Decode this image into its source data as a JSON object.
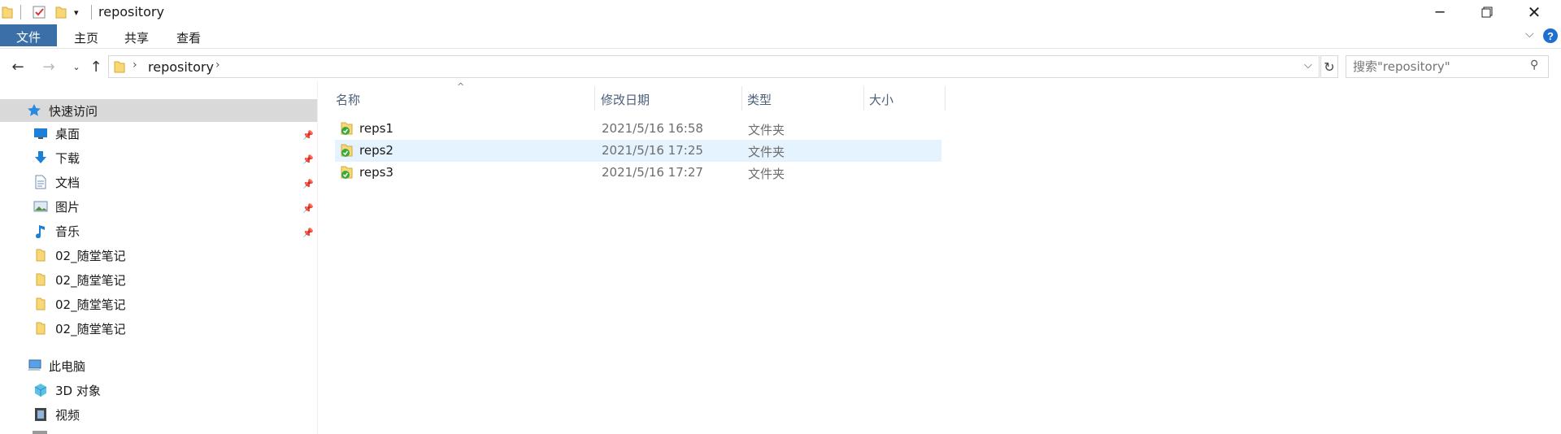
{
  "window": {
    "title": "repository",
    "controls": [
      "minimize",
      "maximize",
      "close"
    ]
  },
  "ribbon": {
    "tabs": [
      {
        "label": "文件",
        "active": true
      },
      {
        "label": "主页",
        "active": false
      },
      {
        "label": "共享",
        "active": false
      },
      {
        "label": "查看",
        "active": false
      }
    ],
    "help_icon": "help-icon",
    "expand_icon": "chevron-down-icon"
  },
  "address": {
    "breadcrumb": "repository",
    "search_placeholder": "搜索\"repository\""
  },
  "sidebar": {
    "quick_access": "快速访问",
    "items": [
      {
        "label": "桌面",
        "icon": "desktop-icon",
        "pinned": true
      },
      {
        "label": "下载",
        "icon": "download-icon",
        "pinned": true
      },
      {
        "label": "文档",
        "icon": "document-icon",
        "pinned": true
      },
      {
        "label": "图片",
        "icon": "picture-icon",
        "pinned": true
      },
      {
        "label": "音乐",
        "icon": "music-icon",
        "pinned": true
      },
      {
        "label": "02_随堂笔记",
        "icon": "folder-icon",
        "pinned": false
      },
      {
        "label": "02_随堂笔记",
        "icon": "folder-icon",
        "pinned": false
      },
      {
        "label": "02_随堂笔记",
        "icon": "folder-icon",
        "pinned": false
      },
      {
        "label": "02_随堂笔记",
        "icon": "folder-icon",
        "pinned": false
      }
    ],
    "this_pc": "此电脑",
    "pc_items": [
      {
        "label": "3D 对象",
        "icon": "3d-objects-icon"
      },
      {
        "label": "视频",
        "icon": "video-icon"
      }
    ]
  },
  "file_list": {
    "columns": [
      "名称",
      "修改日期",
      "类型",
      "大小"
    ],
    "sort_indicator": "sort-up-icon",
    "rows": [
      {
        "name": "reps1",
        "date": "2021/5/16 16:58",
        "type": "文件夹",
        "size": "",
        "selected": false
      },
      {
        "name": "reps2",
        "date": "2021/5/16 17:25",
        "type": "文件夹",
        "size": "",
        "selected": true
      },
      {
        "name": "reps3",
        "date": "2021/5/16 17:27",
        "type": "文件夹",
        "size": "",
        "selected": false
      }
    ]
  },
  "colors": {
    "accent": "#3b6fa8",
    "selection": "#e5f3ff",
    "quick_access_bg": "#d9d9d9",
    "folder": "#f8d775",
    "sync_green": "#3aa83a"
  }
}
